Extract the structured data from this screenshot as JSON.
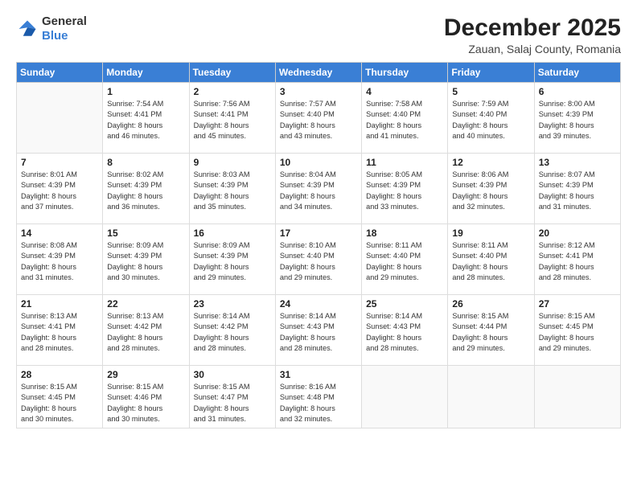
{
  "header": {
    "logo_general": "General",
    "logo_blue": "Blue",
    "title": "December 2025",
    "subtitle": "Zauan, Salaj County, Romania"
  },
  "calendar": {
    "weekdays": [
      "Sunday",
      "Monday",
      "Tuesday",
      "Wednesday",
      "Thursday",
      "Friday",
      "Saturday"
    ],
    "weeks": [
      [
        {
          "day": "",
          "sunrise": "",
          "sunset": "",
          "daylight": ""
        },
        {
          "day": "1",
          "sunrise": "Sunrise: 7:54 AM",
          "sunset": "Sunset: 4:41 PM",
          "daylight": "Daylight: 8 hours and 46 minutes."
        },
        {
          "day": "2",
          "sunrise": "Sunrise: 7:56 AM",
          "sunset": "Sunset: 4:41 PM",
          "daylight": "Daylight: 8 hours and 45 minutes."
        },
        {
          "day": "3",
          "sunrise": "Sunrise: 7:57 AM",
          "sunset": "Sunset: 4:40 PM",
          "daylight": "Daylight: 8 hours and 43 minutes."
        },
        {
          "day": "4",
          "sunrise": "Sunrise: 7:58 AM",
          "sunset": "Sunset: 4:40 PM",
          "daylight": "Daylight: 8 hours and 41 minutes."
        },
        {
          "day": "5",
          "sunrise": "Sunrise: 7:59 AM",
          "sunset": "Sunset: 4:40 PM",
          "daylight": "Daylight: 8 hours and 40 minutes."
        },
        {
          "day": "6",
          "sunrise": "Sunrise: 8:00 AM",
          "sunset": "Sunset: 4:39 PM",
          "daylight": "Daylight: 8 hours and 39 minutes."
        }
      ],
      [
        {
          "day": "7",
          "sunrise": "Sunrise: 8:01 AM",
          "sunset": "Sunset: 4:39 PM",
          "daylight": "Daylight: 8 hours and 37 minutes."
        },
        {
          "day": "8",
          "sunrise": "Sunrise: 8:02 AM",
          "sunset": "Sunset: 4:39 PM",
          "daylight": "Daylight: 8 hours and 36 minutes."
        },
        {
          "day": "9",
          "sunrise": "Sunrise: 8:03 AM",
          "sunset": "Sunset: 4:39 PM",
          "daylight": "Daylight: 8 hours and 35 minutes."
        },
        {
          "day": "10",
          "sunrise": "Sunrise: 8:04 AM",
          "sunset": "Sunset: 4:39 PM",
          "daylight": "Daylight: 8 hours and 34 minutes."
        },
        {
          "day": "11",
          "sunrise": "Sunrise: 8:05 AM",
          "sunset": "Sunset: 4:39 PM",
          "daylight": "Daylight: 8 hours and 33 minutes."
        },
        {
          "day": "12",
          "sunrise": "Sunrise: 8:06 AM",
          "sunset": "Sunset: 4:39 PM",
          "daylight": "Daylight: 8 hours and 32 minutes."
        },
        {
          "day": "13",
          "sunrise": "Sunrise: 8:07 AM",
          "sunset": "Sunset: 4:39 PM",
          "daylight": "Daylight: 8 hours and 31 minutes."
        }
      ],
      [
        {
          "day": "14",
          "sunrise": "Sunrise: 8:08 AM",
          "sunset": "Sunset: 4:39 PM",
          "daylight": "Daylight: 8 hours and 31 minutes."
        },
        {
          "day": "15",
          "sunrise": "Sunrise: 8:09 AM",
          "sunset": "Sunset: 4:39 PM",
          "daylight": "Daylight: 8 hours and 30 minutes."
        },
        {
          "day": "16",
          "sunrise": "Sunrise: 8:09 AM",
          "sunset": "Sunset: 4:39 PM",
          "daylight": "Daylight: 8 hours and 29 minutes."
        },
        {
          "day": "17",
          "sunrise": "Sunrise: 8:10 AM",
          "sunset": "Sunset: 4:40 PM",
          "daylight": "Daylight: 8 hours and 29 minutes."
        },
        {
          "day": "18",
          "sunrise": "Sunrise: 8:11 AM",
          "sunset": "Sunset: 4:40 PM",
          "daylight": "Daylight: 8 hours and 29 minutes."
        },
        {
          "day": "19",
          "sunrise": "Sunrise: 8:11 AM",
          "sunset": "Sunset: 4:40 PM",
          "daylight": "Daylight: 8 hours and 28 minutes."
        },
        {
          "day": "20",
          "sunrise": "Sunrise: 8:12 AM",
          "sunset": "Sunset: 4:41 PM",
          "daylight": "Daylight: 8 hours and 28 minutes."
        }
      ],
      [
        {
          "day": "21",
          "sunrise": "Sunrise: 8:13 AM",
          "sunset": "Sunset: 4:41 PM",
          "daylight": "Daylight: 8 hours and 28 minutes."
        },
        {
          "day": "22",
          "sunrise": "Sunrise: 8:13 AM",
          "sunset": "Sunset: 4:42 PM",
          "daylight": "Daylight: 8 hours and 28 minutes."
        },
        {
          "day": "23",
          "sunrise": "Sunrise: 8:14 AM",
          "sunset": "Sunset: 4:42 PM",
          "daylight": "Daylight: 8 hours and 28 minutes."
        },
        {
          "day": "24",
          "sunrise": "Sunrise: 8:14 AM",
          "sunset": "Sunset: 4:43 PM",
          "daylight": "Daylight: 8 hours and 28 minutes."
        },
        {
          "day": "25",
          "sunrise": "Sunrise: 8:14 AM",
          "sunset": "Sunset: 4:43 PM",
          "daylight": "Daylight: 8 hours and 28 minutes."
        },
        {
          "day": "26",
          "sunrise": "Sunrise: 8:15 AM",
          "sunset": "Sunset: 4:44 PM",
          "daylight": "Daylight: 8 hours and 29 minutes."
        },
        {
          "day": "27",
          "sunrise": "Sunrise: 8:15 AM",
          "sunset": "Sunset: 4:45 PM",
          "daylight": "Daylight: 8 hours and 29 minutes."
        }
      ],
      [
        {
          "day": "28",
          "sunrise": "Sunrise: 8:15 AM",
          "sunset": "Sunset: 4:45 PM",
          "daylight": "Daylight: 8 hours and 30 minutes."
        },
        {
          "day": "29",
          "sunrise": "Sunrise: 8:15 AM",
          "sunset": "Sunset: 4:46 PM",
          "daylight": "Daylight: 8 hours and 30 minutes."
        },
        {
          "day": "30",
          "sunrise": "Sunrise: 8:15 AM",
          "sunset": "Sunset: 4:47 PM",
          "daylight": "Daylight: 8 hours and 31 minutes."
        },
        {
          "day": "31",
          "sunrise": "Sunrise: 8:16 AM",
          "sunset": "Sunset: 4:48 PM",
          "daylight": "Daylight: 8 hours and 32 minutes."
        },
        {
          "day": "",
          "sunrise": "",
          "sunset": "",
          "daylight": ""
        },
        {
          "day": "",
          "sunrise": "",
          "sunset": "",
          "daylight": ""
        },
        {
          "day": "",
          "sunrise": "",
          "sunset": "",
          "daylight": ""
        }
      ]
    ]
  }
}
